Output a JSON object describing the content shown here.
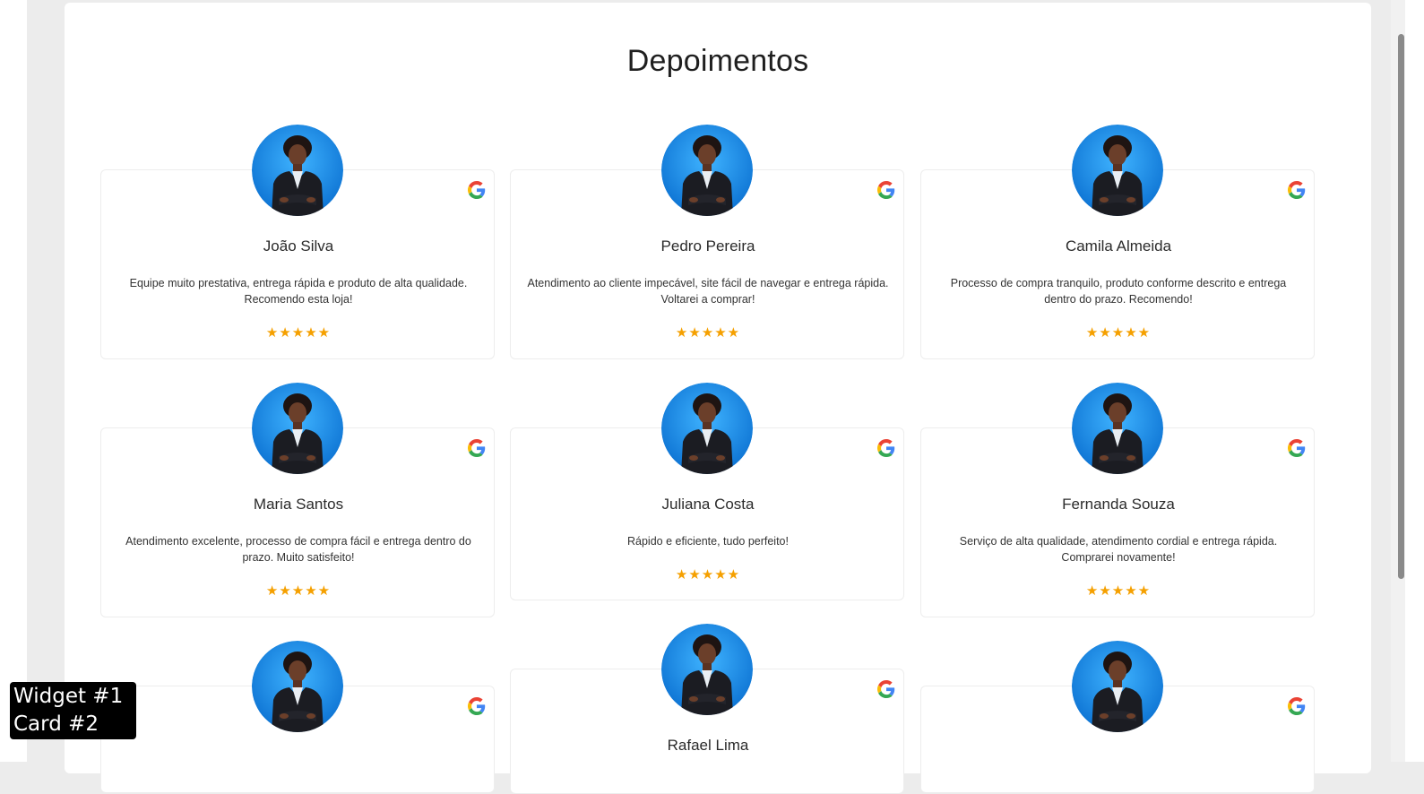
{
  "section_title": "Depoimentos",
  "colors": {
    "star": "#f5a000",
    "avatar_bg": "#1e8fe8",
    "panel": "#ffffff"
  },
  "icons": {
    "source": "google-g-icon",
    "rating": "star-icon"
  },
  "testimonials": [
    {
      "name": "João Silva",
      "text": "Equipe muito prestativa, entrega rápida e produto de alta qualidade. Recomendo esta loja!",
      "stars": "★★★★★",
      "rating": 5
    },
    {
      "name": "Pedro Pereira",
      "text": "Atendimento ao cliente impecável, site fácil de navegar e entrega rápida. Voltarei a comprar!",
      "stars": "★★★★★",
      "rating": 5
    },
    {
      "name": "Camila Almeida",
      "text": "Processo de compra tranquilo, produto conforme descrito e entrega dentro do prazo. Recomendo!",
      "stars": "★★★★★",
      "rating": 5
    },
    {
      "name": "Maria Santos",
      "text": "Atendimento excelente, processo de compra fácil e entrega dentro do prazo. Muito satisfeito!",
      "stars": "★★★★★",
      "rating": 5
    },
    {
      "name": "Juliana Costa",
      "text": "Rápido e eficiente, tudo perfeito!",
      "stars": "★★★★★",
      "rating": 5
    },
    {
      "name": "Fernanda Souza",
      "text": "Serviço de alta qualidade, atendimento cordial e entrega rápida. Comprarei novamente!",
      "stars": "★★★★★",
      "rating": 5
    },
    {
      "name": "",
      "text": "",
      "stars": ""
    },
    {
      "name": "Rafael Lima",
      "text": "",
      "stars": ""
    },
    {
      "name": "",
      "text": "",
      "stars": ""
    }
  ],
  "overlay": {
    "line1": "Widget #1",
    "line2": "Card #2"
  }
}
